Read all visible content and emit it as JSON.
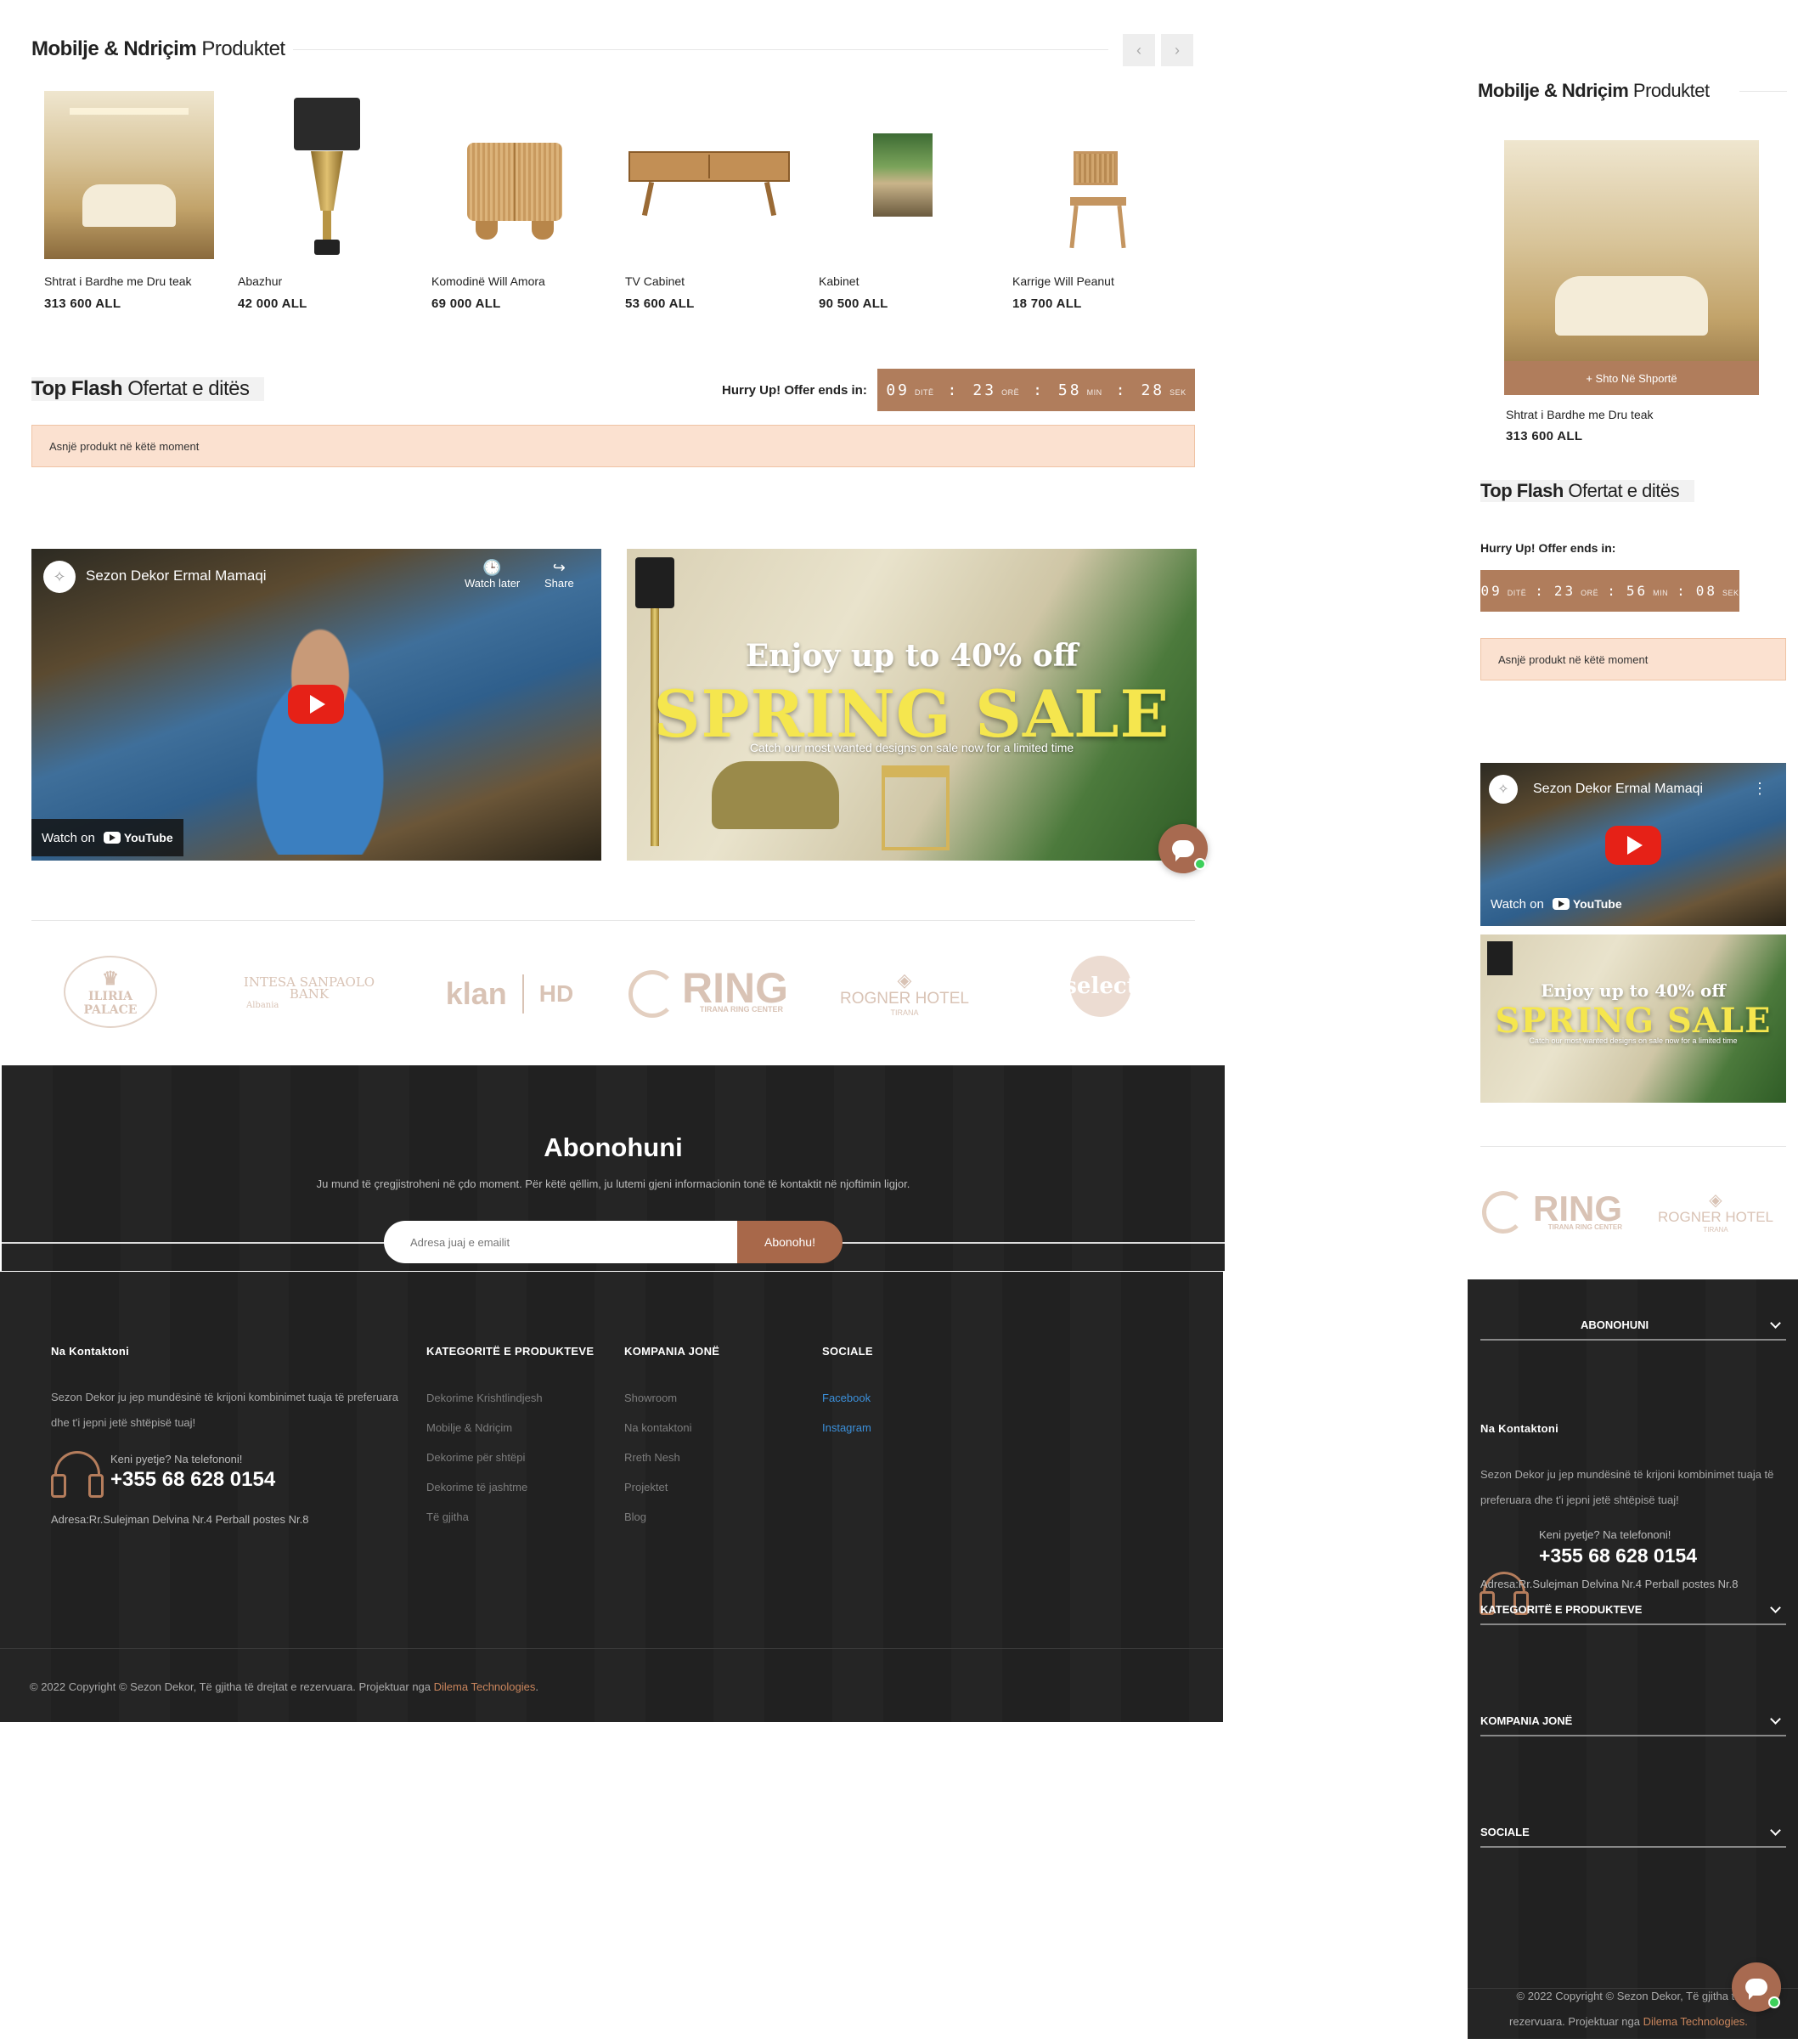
{
  "section_products": {
    "title_bold": "Mobilje & Ndriçim",
    "title_light": "Produktet",
    "prev": "‹",
    "next": "›"
  },
  "products": [
    {
      "name": "Shtrat i Bardhe me Dru teak",
      "price": "313 600 ALL"
    },
    {
      "name": "Abazhur",
      "price": "42 000 ALL"
    },
    {
      "name": "Komodinë Will Amora",
      "price": "69 000 ALL"
    },
    {
      "name": "TV Cabinet",
      "price": "53 600 ALL"
    },
    {
      "name": "Kabinet",
      "price": "90 500 ALL"
    },
    {
      "name": "Karrige Will Peanut",
      "price": "18 700 ALL"
    }
  ],
  "flash": {
    "title_bold": "Top Flash",
    "title_light": "Ofertat e ditës",
    "hurry": "Hurry Up! Offer ends in:",
    "notice": "Asnjë produkt në këtë moment"
  },
  "timer_desktop": {
    "days": "09",
    "days_l": "DITË",
    "hours": "23",
    "hours_l": "ORË",
    "min": "58",
    "min_l": "MIN",
    "sec": "28",
    "sec_l": "SEK",
    "sep": ":"
  },
  "timer_mobile": {
    "days": "09",
    "days_l": "DITË",
    "hours": "23",
    "hours_l": "ORË",
    "min": "56",
    "min_l": "MIN",
    "sec": "08",
    "sec_l": "SEK",
    "sep": ":"
  },
  "video": {
    "title": "Sezon Dekor Ermal Mamaqi",
    "watch_later": "Watch later",
    "share": "Share",
    "watch_on": "Watch on",
    "youtube": "YouTube"
  },
  "sale": {
    "enjoy": "Enjoy up to 40% off",
    "big": "SPRING SALE",
    "sub": "Catch our most wanted designs on sale now for a limited time"
  },
  "partners": [
    "ILIRIA PALACE",
    "INTESA SANPAOLO BANK",
    "Albania",
    "klan",
    "HD",
    "RING",
    "TIRANA RING CENTER",
    "ROGNER HOTEL",
    "TIRANA",
    "select"
  ],
  "subscribe": {
    "title": "Abonohuni",
    "desc": "Ju mund të çregjistroheni në çdo moment. Për këtë qëllim, ju lutemi gjeni informacionin tonë të kontaktit në njoftimin ligjor.",
    "placeholder": "Adresa juaj e emailit",
    "button": "Abonohu!"
  },
  "contact": {
    "heading": "Na Kontaktoni",
    "text": "Sezon Dekor ju jep mundësinë të krijoni kombinimet tuaja të preferuara dhe t'i jepni jetë shtëpisë tuaj!",
    "question": "Keni pyetje? Na telefononi!",
    "phone": "+355 68 628 0154",
    "address": "Adresa:Rr.Sulejman Delvina Nr.4 Perball postes Nr.8"
  },
  "footer_cols": {
    "categories": {
      "heading": "KATEGORITË E PRODUKTEVE",
      "links": [
        "Dekorime Krishtlindjesh",
        "Mobilje & Ndriçim",
        "Dekorime për shtëpi",
        "Dekorime të jashtme",
        "Të gjitha"
      ]
    },
    "company": {
      "heading": "KOMPANIA JONË",
      "links": [
        "Showroom",
        "Na kontaktoni",
        "Rreth Nesh",
        "Projektet",
        "Blog"
      ]
    },
    "social": {
      "heading": "SOCIALE",
      "links": [
        "Facebook",
        "Instagram"
      ]
    }
  },
  "copyright": {
    "text": "© 2022 Copyright © Sezon Dekor, Të gjitha të drejtat e rezervuara. Projektuar nga",
    "link": "Dilema Technologies",
    "dot": "."
  },
  "mobile": {
    "add_to_cart": "+ Shto Në Shportë",
    "subscribe_heading": "ABONOHUNI",
    "copyright_l1": "© 2022 Copyright © Sezon Dekor, Të gjitha të",
    "copyright_l2": "rezervuara. Projektuar nga",
    "copyright_link": "Dilema Technologies."
  },
  "colors": {
    "accent": "#b07d5c",
    "notice_bg": "#fbe1d0",
    "footer_bg": "#222222",
    "link_blue": "#3b8fd9"
  }
}
